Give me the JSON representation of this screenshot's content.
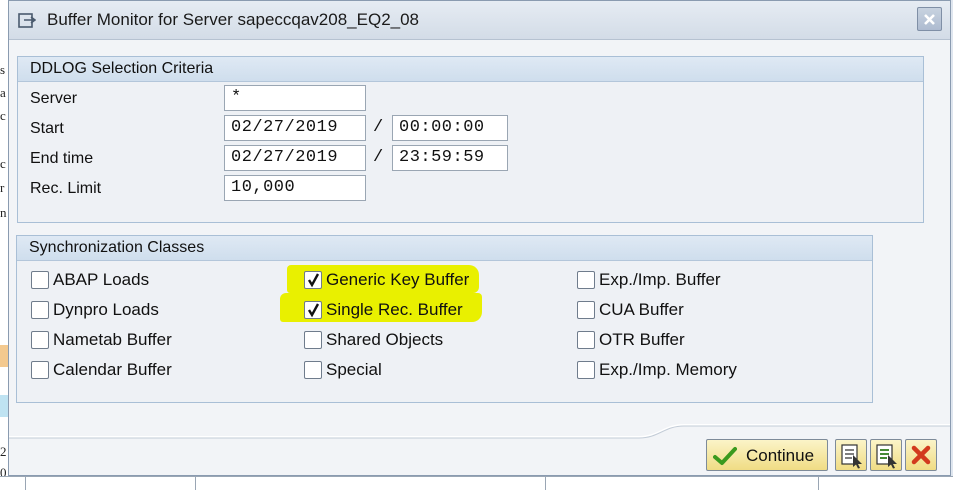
{
  "dialog": {
    "title": "Buffer Monitor for Server sapeccqav208_EQ2_08"
  },
  "criteria": {
    "title": "DDLOG Selection Criteria",
    "server_label": "Server",
    "server_value": "*",
    "start_label": "Start",
    "start_date": "02/27/2019",
    "start_time": "00:00:00",
    "end_label": "End time",
    "end_date": "02/27/2019",
    "end_time": "23:59:59",
    "limit_label": "Rec. Limit",
    "limit_value": "10,000",
    "separator": "/"
  },
  "sync": {
    "title": "Synchronization Classes",
    "classes": [
      {
        "label": "ABAP Loads",
        "checked": false
      },
      {
        "label": "Dynpro Loads",
        "checked": false
      },
      {
        "label": "Nametab Buffer",
        "checked": false
      },
      {
        "label": "Calendar Buffer",
        "checked": false
      },
      {
        "label": "Generic Key Buffer",
        "checked": true,
        "highlighted": true
      },
      {
        "label": "Single Rec. Buffer",
        "checked": true,
        "highlighted": true
      },
      {
        "label": "Shared Objects",
        "checked": false
      },
      {
        "label": "Special",
        "checked": false
      },
      {
        "label": "Exp./Imp. Buffer",
        "checked": false
      },
      {
        "label": "CUA Buffer",
        "checked": false
      },
      {
        "label": "OTR Buffer",
        "checked": false
      },
      {
        "label": "Exp./Imp. Memory",
        "checked": false
      }
    ],
    "highlight_color": "#e9f000"
  },
  "footer": {
    "continue_label": "Continue",
    "icons": [
      "continue-check-icon",
      "select-all-icon",
      "deselect-icon",
      "cancel-icon"
    ]
  },
  "background": {
    "left_letters": [
      "s",
      "a",
      "c",
      "c",
      "r",
      "n",
      "2",
      "0"
    ]
  },
  "colors": {
    "accent_check": "#3a9a1e",
    "cancel_red": "#d23a1e",
    "button_yellow": "#f0dc84"
  }
}
